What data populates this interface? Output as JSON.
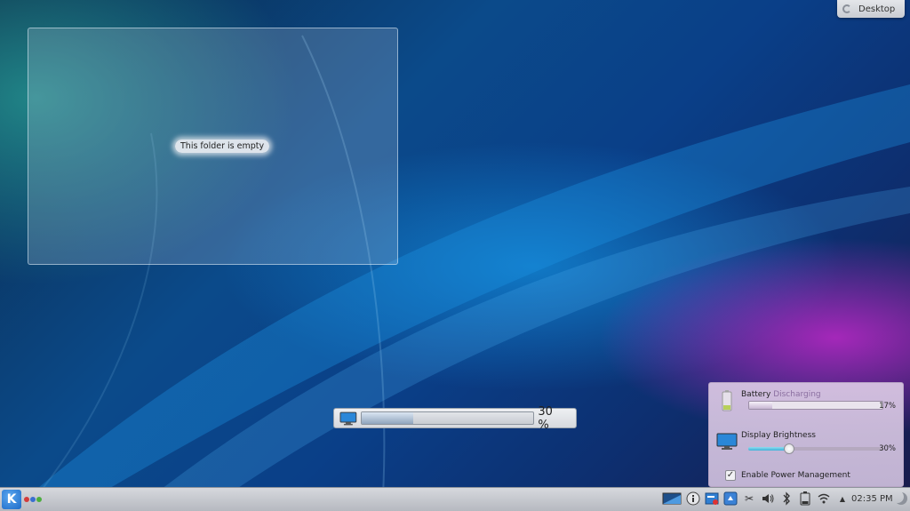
{
  "desktop_toolbox": {
    "label": "Desktop"
  },
  "folder_view": {
    "empty_text": "This folder is empty"
  },
  "osd": {
    "brightness_percent": 30,
    "text": "30 %"
  },
  "battery_popup": {
    "battery": {
      "label": "Battery",
      "status": "Discharging",
      "percent": 17,
      "percent_text": "17%"
    },
    "display": {
      "label": "Display Brightness",
      "percent": 30,
      "percent_text": "30%"
    },
    "power_management": {
      "label": "Enable Power Management",
      "checked": true
    }
  },
  "taskbar": {
    "clock": "02:35 PM",
    "tray_icons": [
      "desktop-preview-icon",
      "info-icon",
      "notes-icon",
      "device-notifier-icon",
      "clipboard-icon",
      "volume-icon",
      "bluetooth-icon",
      "battery-icon",
      "wifi-icon",
      "expand-arrow-icon"
    ]
  },
  "colors": {
    "kde_blue": "#1d6bc8",
    "slider_blue": "#3fb2d8",
    "pager_red": "#d33b3b",
    "pager_blue": "#3a6fd0",
    "pager_green": "#4cae3f"
  }
}
